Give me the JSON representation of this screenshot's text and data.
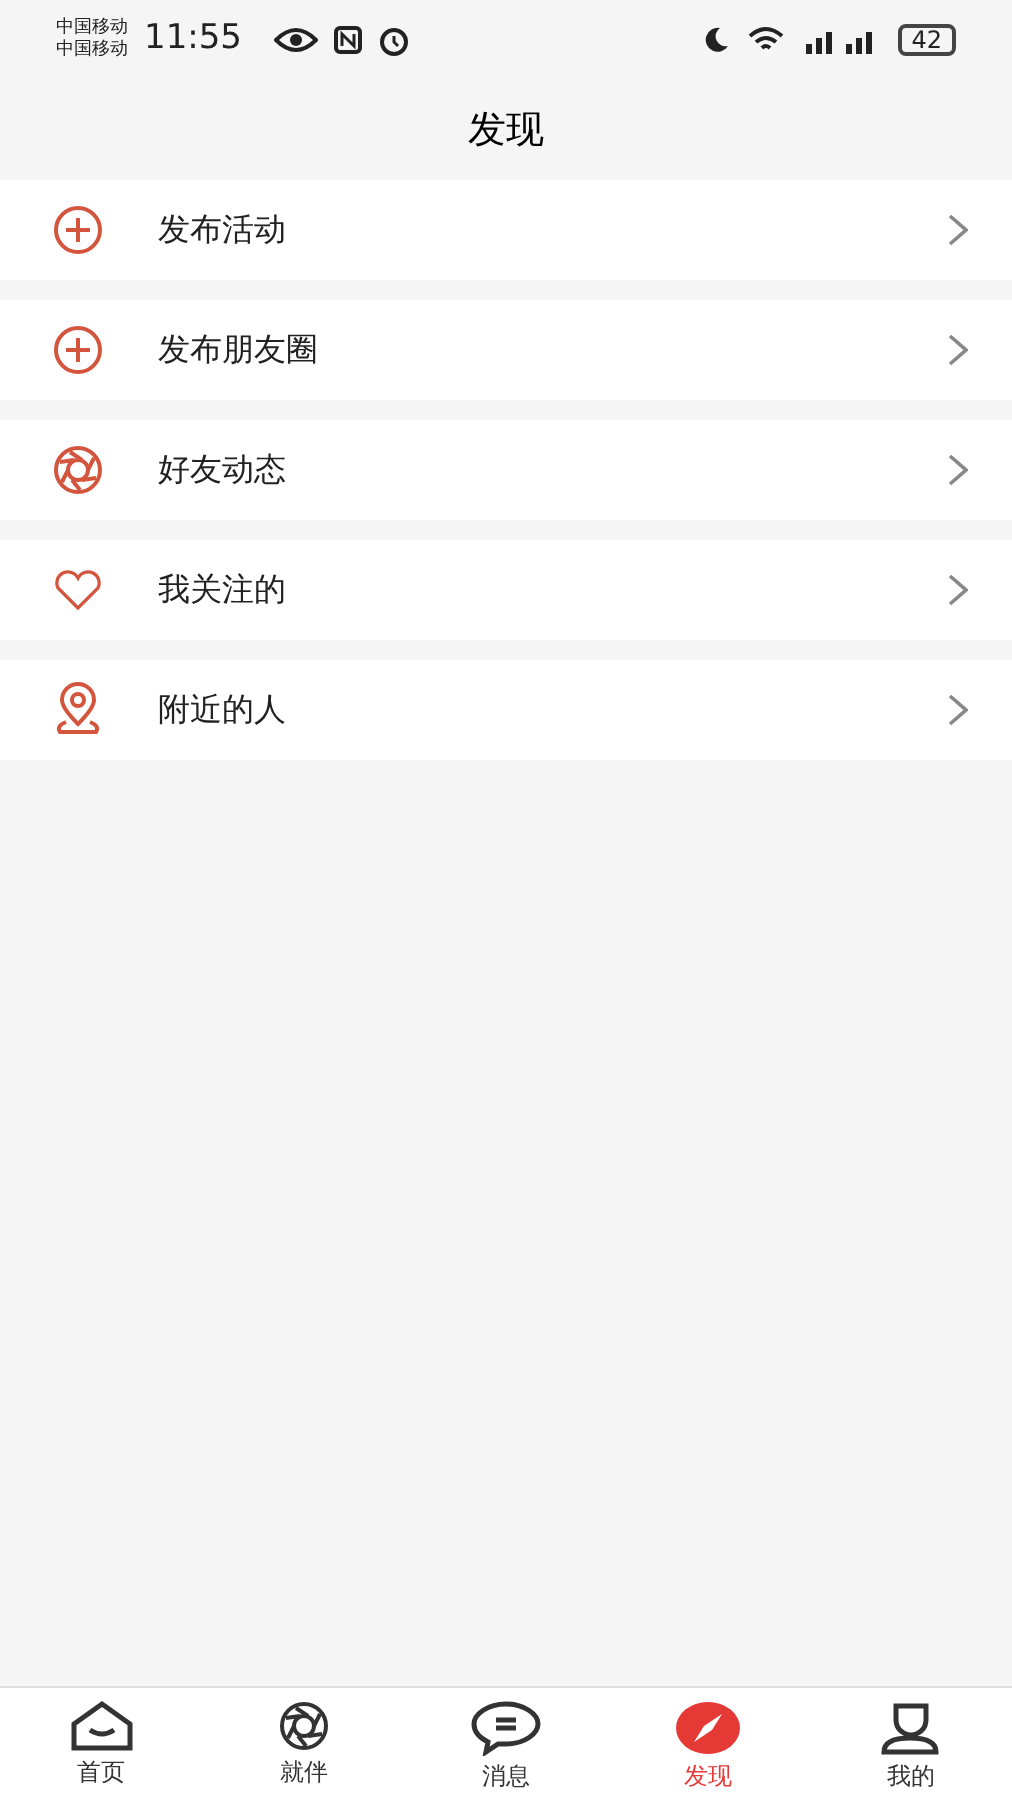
{
  "status_bar": {
    "carriers": [
      "中国移动",
      "中国移动"
    ],
    "time": "11:55",
    "battery": "42"
  },
  "title": "发现",
  "items": [
    {
      "label": "发布活动",
      "kind": "plus"
    },
    {
      "label": "发布朋友圈",
      "kind": "plus"
    },
    {
      "label": "好友动态",
      "kind": "aperture"
    },
    {
      "label": "我关注的",
      "kind": "heart"
    },
    {
      "label": "附近的人",
      "kind": "pin"
    }
  ],
  "tabs": [
    {
      "label": "首页",
      "kind": "home",
      "selected": false
    },
    {
      "label": "就伴",
      "kind": "aperture",
      "selected": false
    },
    {
      "label": "消息",
      "kind": "chat",
      "selected": false
    },
    {
      "label": "发现",
      "kind": "compass",
      "selected": true
    },
    {
      "label": "我的",
      "kind": "person",
      "selected": false
    }
  ]
}
